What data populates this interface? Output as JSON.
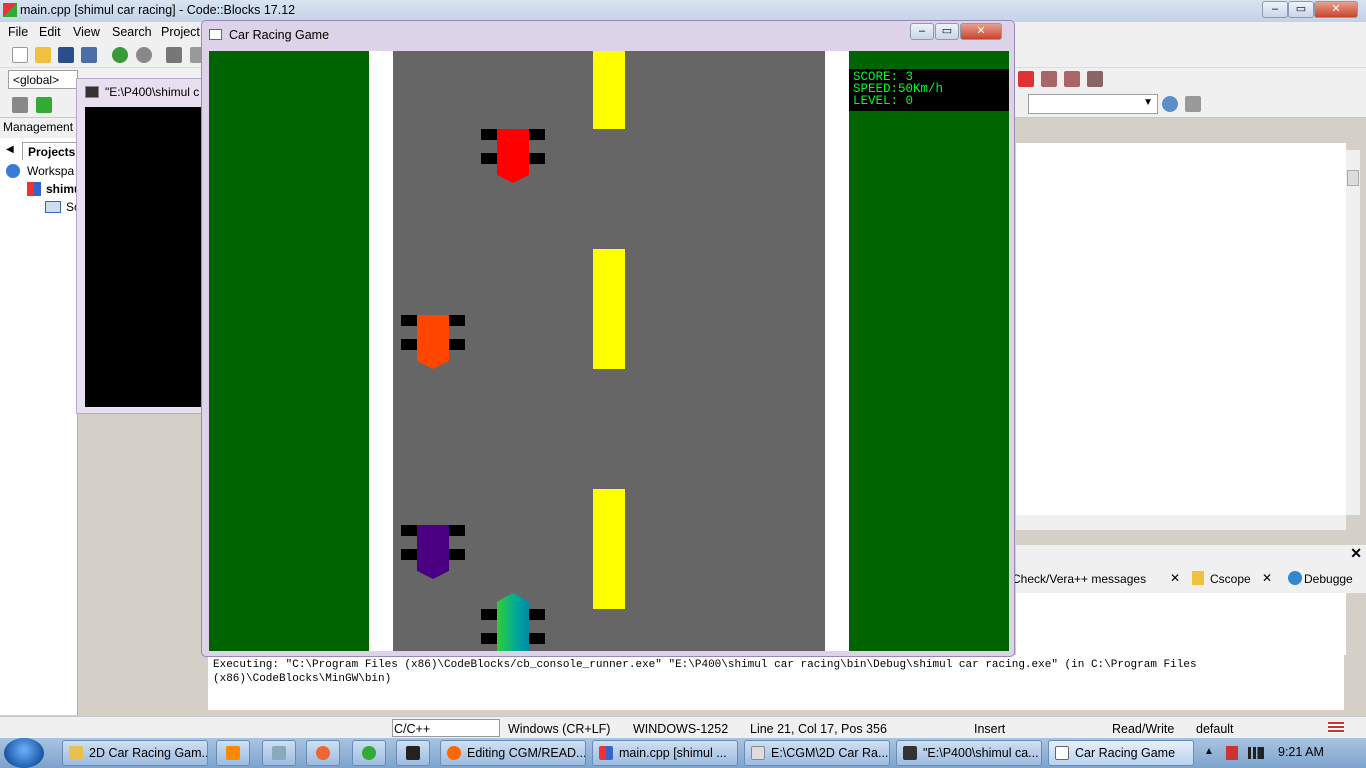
{
  "ide": {
    "title": "main.cpp [shimul car racing] - Code::Blocks 17.12",
    "menu": [
      "File",
      "Edit",
      "View",
      "Search",
      "Project"
    ],
    "scope_combo": "<global>",
    "management_label": "Management",
    "projects_tab": "Projects",
    "tree": [
      "Workspa",
      "shimu",
      "So"
    ],
    "log_tabs": [
      "Check/Vera++ messages",
      "Cscope",
      "Debugge"
    ],
    "log_text": "Executing: \"C:\\Program Files (x86)\\CodeBlocks/cb_console_runner.exe\" \"E:\\P400\\shimul car racing\\bin\\Debug\\shimul car racing.exe\"  (in C:\\Program Files (x86)\\CodeBlocks\\MinGW\\bin)",
    "status": {
      "language": "C/C++",
      "eol": "Windows (CR+LF)",
      "encoding": "WINDOWS-1252",
      "position": "Line 21, Col 17, Pos 356",
      "mode": "Insert",
      "access": "Read/Write",
      "profile": "default"
    }
  },
  "console": {
    "title": "\"E:\\P400\\shimul c"
  },
  "game": {
    "title": "Car Racing Game",
    "hud": {
      "score": "SCORE: 3",
      "speed": "SPEED:50Km/h",
      "level": "LEVEL: 0"
    },
    "colors": {
      "grass": "#006400",
      "road": "#666666",
      "stripe": "#ffff00",
      "car1": "#ff0000",
      "car2": "#ff4500",
      "car3": "#4b0082"
    }
  },
  "taskbar": {
    "tasks": [
      "2D Car Racing Gam...",
      "",
      "",
      "",
      "",
      "",
      "Editing CGM/READ...",
      "main.cpp [shimul ...",
      "E:\\CGM\\2D Car Ra...",
      "\"E:\\P400\\shimul ca...",
      "Car Racing Game"
    ],
    "clock": "9:21 AM"
  }
}
